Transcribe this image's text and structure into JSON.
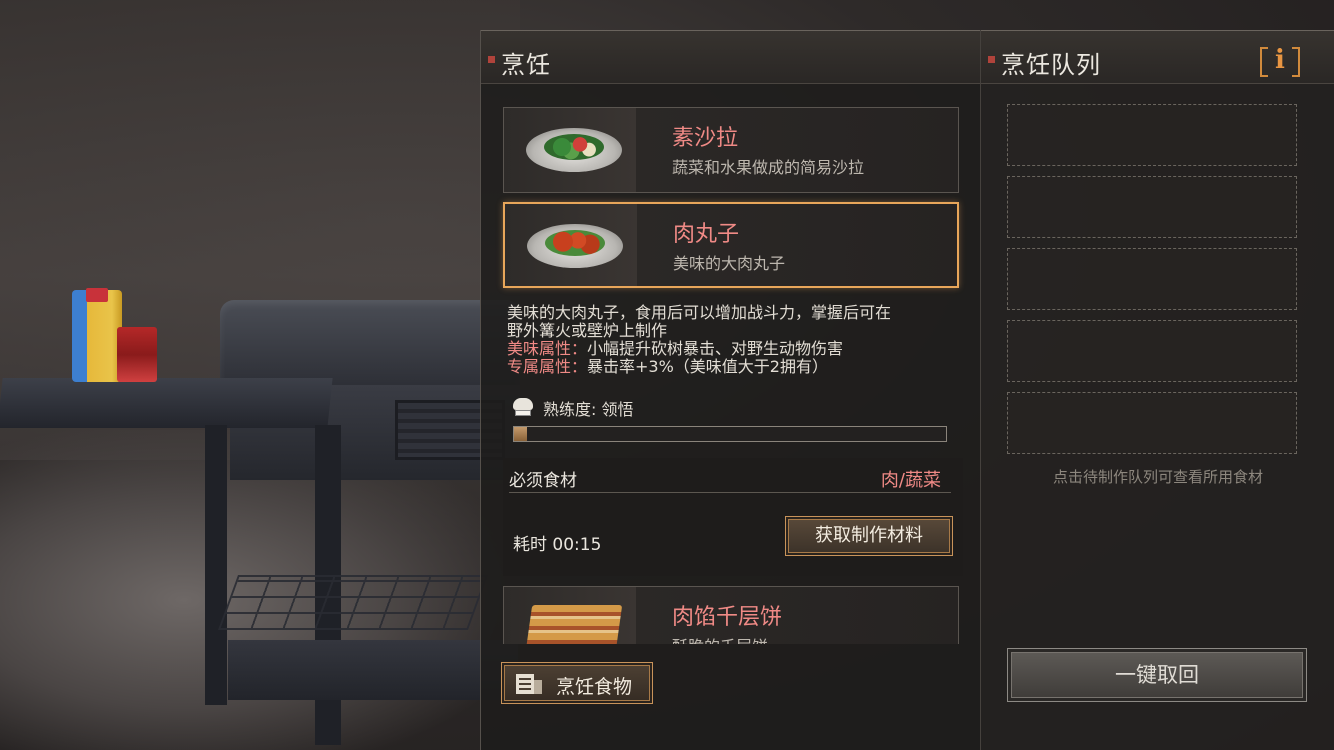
{
  "cooking_panel": {
    "title": "烹饪",
    "recipes": [
      {
        "name": "素沙拉",
        "desc": "蔬菜和水果做成的简易沙拉"
      },
      {
        "name": "肉丸子",
        "desc": "美味的大肉丸子"
      },
      {
        "name": "肉馅千层饼",
        "desc": "酥脆的千层饼"
      }
    ],
    "selected_index": 1,
    "details": {
      "line1": "美味的大肉丸子，食用后可以增加战斗力，掌握后可在",
      "line2": "野外篝火或壁炉上制作",
      "attr1_label": "美味属性：",
      "attr1_value": "小幅提升砍树暴击、对野生动物伤害",
      "attr2_label": "专属属性：",
      "attr2_value": "暴击率+3%（美味值大于2拥有）"
    },
    "mastery_label": "熟练度: 领悟",
    "mastery_progress": 0.03,
    "ingredients_label": "必须食材",
    "ingredients_type": "肉/蔬菜",
    "time_label": "耗时 00:15",
    "get_materials_button": "获取制作材料",
    "cook_button": "烹饪食物"
  },
  "queue_panel": {
    "title": "烹饪队列",
    "info_label": "i",
    "slot_count": 5,
    "hint": "点击待制作队列可查看所用食材",
    "recall_button": "一键取回"
  },
  "colors": {
    "accent_orange": "#e8a65a",
    "recipe_name": "#f08a86",
    "marker_red": "#b0433b"
  }
}
